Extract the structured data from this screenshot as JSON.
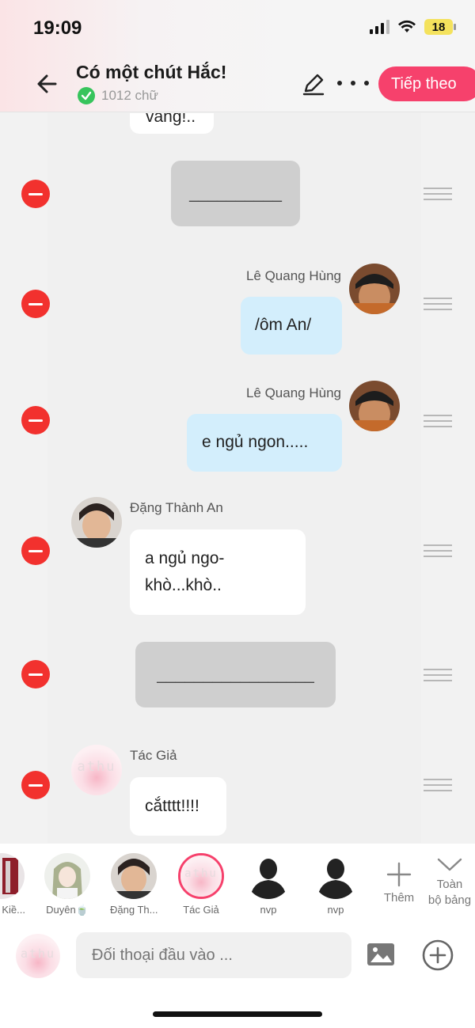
{
  "status_bar": {
    "time": "19:09",
    "battery": "18"
  },
  "header": {
    "title": "Có một chút Hắc!",
    "word_count": "1012 chữ",
    "next_button": "Tiếp theo"
  },
  "messages": [
    {
      "type": "text",
      "align": "left",
      "speaker": "",
      "text": "vâng!.."
    },
    {
      "type": "divider",
      "text": "__________"
    },
    {
      "type": "text",
      "align": "right",
      "speaker": "Lê Quang Hùng",
      "text": "/ôm An/"
    },
    {
      "type": "text",
      "align": "right",
      "speaker": "Lê Quang Hùng",
      "text": "e ngủ ngon....."
    },
    {
      "type": "text",
      "align": "left",
      "speaker": "Đặng Thành An",
      "text_line1": "a ngủ ngo-",
      "text_line2": "khò...khò.."
    },
    {
      "type": "divider",
      "text": "_________________"
    },
    {
      "type": "text",
      "align": "left",
      "speaker": "Tác Giả",
      "text": "cắtttt!!!!",
      "avatar_text": "athu"
    }
  ],
  "characters": [
    {
      "label": "Kiề..."
    },
    {
      "label": "Duyên🍵"
    },
    {
      "label": "Đặng Th..."
    },
    {
      "label": "Tác Giả"
    },
    {
      "label": "nvp"
    },
    {
      "label": "nvp"
    }
  ],
  "character_actions": {
    "add": "Thêm",
    "all_line1": "Toàn",
    "all_line2": "bộ bảng"
  },
  "input": {
    "placeholder": "Đối thoại đầu vào ..."
  },
  "colors": {
    "accent": "#f6416c",
    "remove": "#f2312e",
    "bubble_right": "#d3eefc",
    "divider_bubble": "#cfcfcf"
  }
}
